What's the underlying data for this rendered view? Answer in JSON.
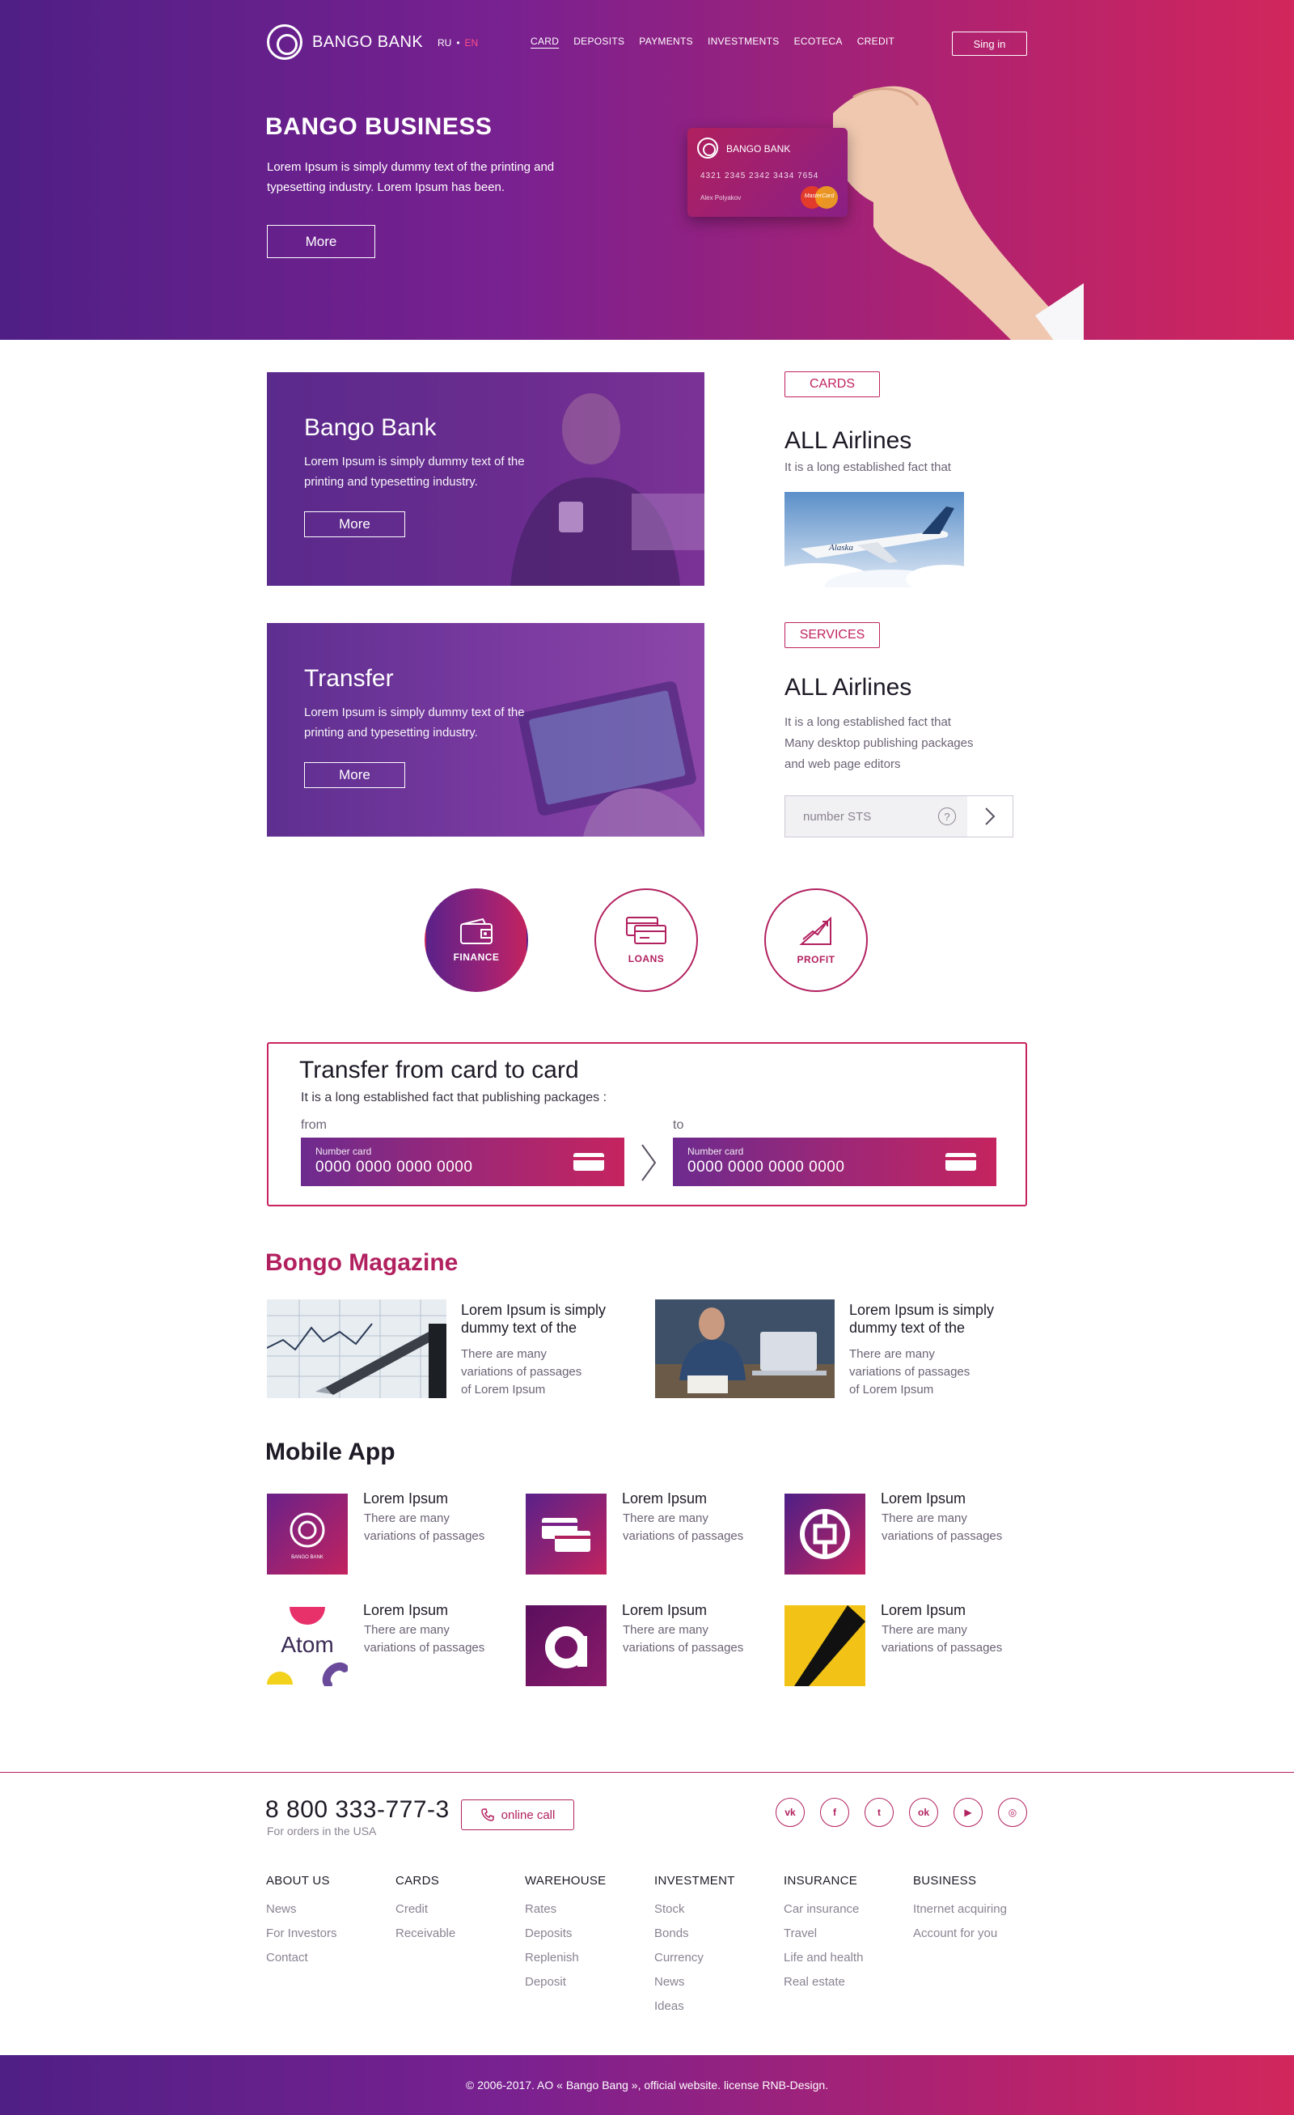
{
  "header": {
    "logo": "BANGO BANK",
    "lang_ru": "RU",
    "lang_sep": "•",
    "lang_en": "EN",
    "nav": [
      "CARD",
      "DEPOSITS",
      "PAYMENTS",
      "INVESTMENTS",
      "ECOTECA",
      "CREDIT"
    ],
    "signin": "Sing in"
  },
  "hero": {
    "title": "BANGO BUSINESS",
    "text": "Lorem Ipsum is simply dummy text of the printing and typesetting industry. Lorem Ipsum has been.",
    "button": "More",
    "card": {
      "bank": "BANGO BANK",
      "number": "4321  2345  2342  3434  7654",
      "holder": "Alex Polyakov",
      "brand": "MasterCard"
    }
  },
  "promos": [
    {
      "title": "Bango Bank",
      "text": "Lorem Ipsum is simply dummy text of the printing and typesetting industry.",
      "button": "More"
    },
    {
      "title": "Transfer",
      "text": "Lorem Ipsum is simply dummy text of the printing and typesetting industry.",
      "button": "More"
    }
  ],
  "side": {
    "cards": {
      "tag": "CARDS",
      "title": "ALL Airlines",
      "text": "It is a long established fact that",
      "plane_logo": "Alaska"
    },
    "services": {
      "tag": "SERVICES",
      "title": "ALL Airlines",
      "text_lines": [
        "It is a long established fact that",
        "Many desktop publishing packages",
        "and web page editors"
      ],
      "field_placeholder": "number  STS",
      "help": "?"
    }
  },
  "categories": [
    {
      "label": "FINANCE",
      "icon": "wallet-icon"
    },
    {
      "label": "LOANS",
      "icon": "cards-icon"
    },
    {
      "label": "PROFIT",
      "icon": "chart-icon"
    }
  ],
  "transfer": {
    "title": "Transfer from card to card",
    "subtitle": "It is a long established fact that publishing packages :",
    "from_label": "from",
    "to_label": "to",
    "from_field": {
      "label": "Number card",
      "value": "0000 0000 0000 0000"
    },
    "to_field": {
      "label": "Number card",
      "value": "0000 0000 0000 0000"
    }
  },
  "magazine": {
    "title": "Bongo Magazine",
    "articles": [
      {
        "heading": "Lorem Ipsum is simply dummy text of the",
        "lines": [
          "There are many",
          "variations of passages",
          "of Lorem Ipsum"
        ]
      },
      {
        "heading": "Lorem Ipsum is simply dummy text of the",
        "lines": [
          "There are many",
          "variations of passages",
          "of Lorem Ipsum"
        ]
      }
    ]
  },
  "mobile_app": {
    "title": "Mobile App",
    "apps": [
      {
        "name": "Lorem Ipsum",
        "line1": "There are many",
        "line2": "variations of passages",
        "icon": "bango-bank-app-icon",
        "icon_caption": "BANGO BANK"
      },
      {
        "name": "Lorem Ipsum",
        "line1": "There are many",
        "line2": "variations of passages",
        "icon": "cards-app-icon"
      },
      {
        "name": "Lorem Ipsum",
        "line1": "There are many",
        "line2": "variations of passages",
        "icon": "bank-of-china-app-icon"
      },
      {
        "name": "Lorem Ipsum",
        "line1": "There are many",
        "line2": "variations of passages",
        "icon": "atom-app-icon",
        "icon_caption": "Atom"
      },
      {
        "name": "Lorem Ipsum",
        "line1": "There are many",
        "line2": "variations of passages",
        "icon": "a-letter-app-icon"
      },
      {
        "name": "Lorem Ipsum",
        "line1": "There are many",
        "line2": "variations of passages",
        "icon": "yellow-black-app-icon"
      }
    ]
  },
  "footer": {
    "phone": "8 800 333-777-3",
    "phone_sub": "For orders in the USA",
    "online_call": "online call",
    "social": [
      "vk-icon",
      "facebook-icon",
      "twitter-icon",
      "odnoklassniki-icon",
      "youtube-icon",
      "instagram-icon"
    ],
    "social_glyphs": [
      "vk",
      "f",
      "t",
      "ok",
      "▶",
      "◎"
    ],
    "columns": [
      {
        "heading": "ABOUT US",
        "links": [
          "News",
          "For Investors",
          "Contact"
        ]
      },
      {
        "heading": "CARDS",
        "links": [
          "Credit",
          "Receivable"
        ]
      },
      {
        "heading": "WAREHOUSE",
        "links": [
          "Rates",
          "Deposits",
          "Replenish",
          "Deposit"
        ]
      },
      {
        "heading": "INVESTMENT",
        "links": [
          "Stock",
          "Bonds",
          "Currency",
          "News",
          "Ideas"
        ]
      },
      {
        "heading": "INSURANCE",
        "links": [
          "Car insurance",
          "Travel",
          "Life and health",
          "Real estate"
        ]
      },
      {
        "heading": "BUSINESS",
        "links": [
          "Itnernet acquiring",
          "Account for you"
        ]
      }
    ],
    "copyright": "© 2006-2017. AO « Bango Bang », official website. license RNB-Design."
  },
  "colors": {
    "brand_purple": "#5a2189",
    "brand_magenta": "#b2215f",
    "brand_pink": "#d1265c"
  }
}
